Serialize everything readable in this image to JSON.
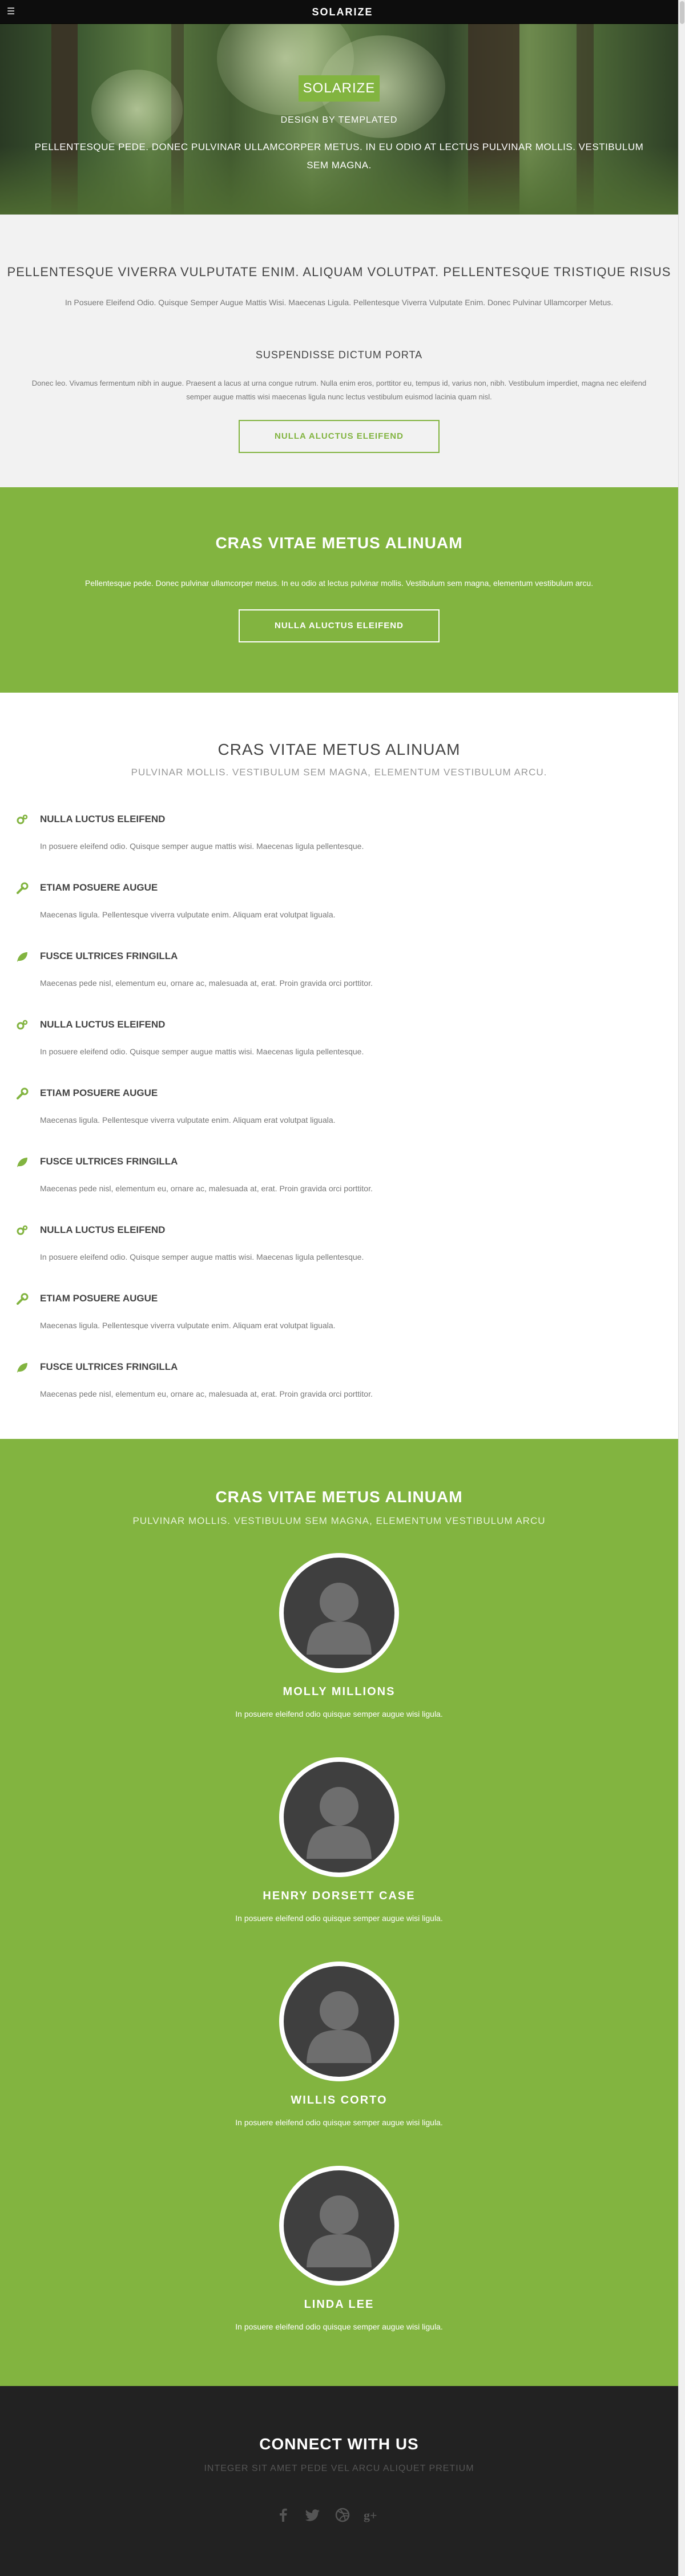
{
  "topbar": {
    "brand": "SOLARIZE",
    "menu_icon": "menu-icon"
  },
  "hero": {
    "logo": "SOLARIZE",
    "tagline": "DESIGN BY TEMPLATED",
    "blurb": "PELLENTESQUE PEDE. DONEC PULVINAR ULLAMCORPER METUS. IN EU ODIO AT LECTUS PULVINAR MOLLIS. VESTIBULUM SEM MAGNA."
  },
  "intro": {
    "heading": "PELLENTESQUE VIVERRA VULPUTATE ENIM. ALIQUAM VOLUTPAT. PELLENTESQUE TRISTIQUE RISUS",
    "subtext": "In Posuere Eleifend Odio. Quisque Semper Augue Mattis Wisi. Maecenas Ligula. Pellentesque Viverra Vulputate Enim. Donec Pulvinar Ullamcorper Metus.",
    "sub2_title": "SUSPENDISSE DICTUM PORTA",
    "sub2_text": "Donec leo. Vivamus fermentum nibh in augue. Praesent a lacus at urna congue rutrum. Nulla enim eros, porttitor eu, tempus id, varius non, nibh. Vestibulum imperdiet, magna nec eleifend semper augue mattis wisi maecenas ligula nunc lectus vestibulum euismod lacinia quam nisl.",
    "button_label": "NULLA ALUCTUS ELEIFEND"
  },
  "cta": {
    "heading": "CRAS VITAE METUS ALINUAM",
    "text": "Pellentesque pede. Donec pulvinar ullamcorper metus. In eu odio at lectus pulvinar mollis. Vestibulum sem magna, elementum vestibulum arcu.",
    "button_label": "NULLA ALUCTUS ELEIFEND"
  },
  "features": {
    "heading": "CRAS VITAE METUS ALINUAM",
    "subheading": "PULVINAR MOLLIS. VESTIBULUM SEM MAGNA, ELEMENTUM VESTIBULUM ARCU.",
    "items": [
      {
        "icon": "cogs-icon",
        "title": "NULLA LUCTUS ELEIFEND",
        "text": "In posuere eleifend odio. Quisque semper augue mattis wisi. Maecenas ligula pellentesque."
      },
      {
        "icon": "wrench-icon",
        "title": "ETIAM POSUERE AUGUE",
        "text": "Maecenas ligula. Pellentesque viverra vulputate enim. Aliquam erat volutpat liguala."
      },
      {
        "icon": "leaf-icon",
        "title": "FUSCE ULTRICES FRINGILLA",
        "text": "Maecenas pede nisl, elementum eu, ornare ac, malesuada at, erat. Proin gravida orci porttitor."
      },
      {
        "icon": "cogs-icon",
        "title": "NULLA LUCTUS ELEIFEND",
        "text": "In posuere eleifend odio. Quisque semper augue mattis wisi. Maecenas ligula pellentesque."
      },
      {
        "icon": "wrench-icon",
        "title": "ETIAM POSUERE AUGUE",
        "text": "Maecenas ligula. Pellentesque viverra vulputate enim. Aliquam erat volutpat liguala."
      },
      {
        "icon": "leaf-icon",
        "title": "FUSCE ULTRICES FRINGILLA",
        "text": "Maecenas pede nisl, elementum eu, ornare ac, malesuada at, erat. Proin gravida orci porttitor."
      },
      {
        "icon": "cogs-icon",
        "title": "NULLA LUCTUS ELEIFEND",
        "text": "In posuere eleifend odio. Quisque semper augue mattis wisi. Maecenas ligula pellentesque."
      },
      {
        "icon": "wrench-icon",
        "title": "ETIAM POSUERE AUGUE",
        "text": "Maecenas ligula. Pellentesque viverra vulputate enim. Aliquam erat volutpat liguala."
      },
      {
        "icon": "leaf-icon",
        "title": "FUSCE ULTRICES FRINGILLA",
        "text": "Maecenas pede nisl, elementum eu, ornare ac, malesuada at, erat. Proin gravida orci porttitor."
      }
    ]
  },
  "team": {
    "heading": "CRAS VITAE METUS ALINUAM",
    "subheading": "PULVINAR MOLLIS. VESTIBULUM SEM MAGNA, ELEMENTUM VESTIBULUM ARCU",
    "members": [
      {
        "name": "MOLLY MILLIONS",
        "text": "In posuere eleifend odio quisque semper augue wisi ligula."
      },
      {
        "name": "HENRY DORSETT CASE",
        "text": "In posuere eleifend odio quisque semper augue wisi ligula."
      },
      {
        "name": "WILLIS CORTO",
        "text": "In posuere eleifend odio quisque semper augue wisi ligula."
      },
      {
        "name": "LINDA LEE",
        "text": "In posuere eleifend odio quisque semper augue wisi ligula."
      }
    ]
  },
  "footer": {
    "heading": "CONNECT WITH US",
    "subtext": "INTEGER SIT AMET PEDE VEL ARCU ALIQUET PRETIUM",
    "social": [
      "facebook-icon",
      "twitter-icon",
      "dribbble-icon",
      "google-plus-icon"
    ]
  },
  "colors": {
    "accent": "#82b440",
    "dark": "#222222",
    "topbar": "#0d0d0d",
    "light_bg": "#f2f2f2"
  }
}
